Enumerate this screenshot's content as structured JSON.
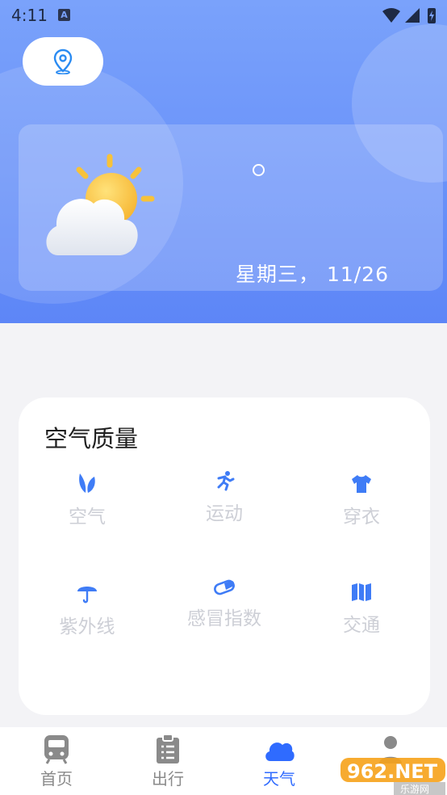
{
  "status_bar": {
    "time": "4:11",
    "notification_letter": "A"
  },
  "header": {
    "location_icon": "location-pin-icon"
  },
  "weather": {
    "icon": "sun-behind-cloud-icon",
    "date": "星期三， 11/26"
  },
  "air_quality": {
    "title": "空气质量",
    "items": [
      {
        "label": "空气",
        "icon": "leaf-icon"
      },
      {
        "label": "运动",
        "icon": "running-icon"
      },
      {
        "label": "穿衣",
        "icon": "shirt-icon"
      },
      {
        "label": "紫外线",
        "icon": "umbrella-icon"
      },
      {
        "label": "感冒指数",
        "icon": "pill-icon"
      },
      {
        "label": "交通",
        "icon": "map-icon"
      }
    ]
  },
  "tabs": [
    {
      "label": "首页",
      "icon": "train-icon",
      "active": false
    },
    {
      "label": "出行",
      "icon": "clipboard-icon",
      "active": false
    },
    {
      "label": "天气",
      "icon": "cloud-icon",
      "active": true
    },
    {
      "label": "",
      "icon": "user-icon",
      "active": false
    }
  ],
  "watermark": {
    "text": "962.NET",
    "sub": "乐游网"
  },
  "colors": {
    "accent": "#2f6bff",
    "hero_top": "#7aa2fb",
    "hero_bottom": "#5d86f7",
    "inactive_label": "#cdcfd6"
  }
}
